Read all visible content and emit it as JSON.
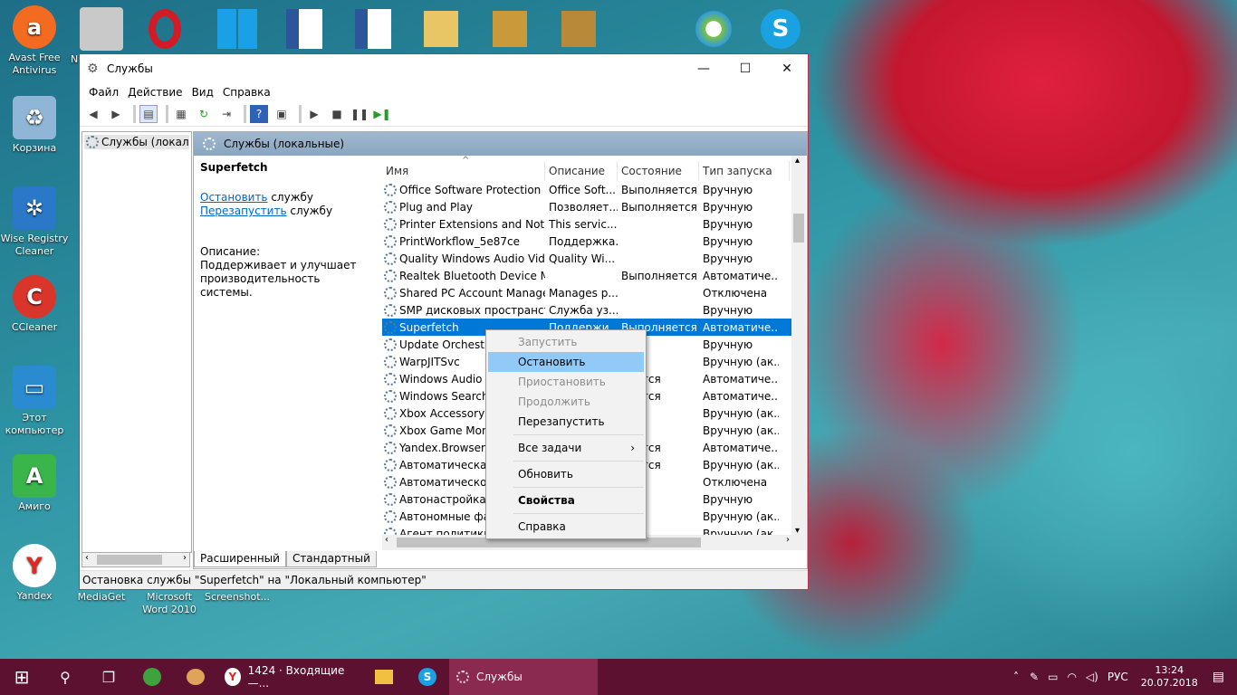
{
  "desktop": {
    "icons": [
      {
        "label": "Avast Free Antivirus",
        "glyph": "a",
        "color": "#f36b21"
      },
      {
        "label": "Корзина",
        "glyph": "♻",
        "color": "#3d7fb5"
      },
      {
        "label": "Wise Registry Cleaner",
        "glyph": "✲",
        "color": "#2a78c7"
      },
      {
        "label": "CCleaner",
        "glyph": "C",
        "color": "#d9352b"
      },
      {
        "label": "Этот компьютер",
        "glyph": "▭",
        "color": "#2a8bd0"
      },
      {
        "label": "Амиго",
        "glyph": "A",
        "color": "#39b54a"
      },
      {
        "label": "Yandex",
        "glyph": "Y",
        "color": "#e52620"
      },
      {
        "label": "MediaGet",
        "glyph": "",
        "color": ""
      },
      {
        "label": "Microsoft Word 2010",
        "glyph": "",
        "color": ""
      },
      {
        "label": "Screenshot...",
        "glyph": "",
        "color": ""
      }
    ],
    "top_row_partial_label": "N"
  },
  "window": {
    "title": "Службы",
    "minimize_glyph": "—",
    "maximize_glyph": "☐",
    "close_glyph": "✕",
    "menu": [
      "Файл",
      "Действие",
      "Вид",
      "Справка"
    ],
    "tree_root": "Службы (локалы",
    "pane_header": "Службы (локальные)",
    "selected_service_title": "Superfetch",
    "stop_link": "Остановить",
    "stop_suffix": " службу",
    "restart_link": "Перезапустить",
    "restart_suffix": " службу",
    "description_label": "Описание:",
    "description_text": "Поддерживает и улучшает производительность системы.",
    "columns": [
      "Имя",
      "Описание",
      "Состояние",
      "Тип запуска"
    ],
    "rows": [
      {
        "name": "Office Software Protection ...",
        "desc": "Office Soft...",
        "state": "Выполняется",
        "start": "Вручную",
        "selected": false
      },
      {
        "name": "Plug and Play",
        "desc": "Позволяет...",
        "state": "Выполняется",
        "start": "Вручную",
        "selected": false
      },
      {
        "name": "Printer Extensions and Notif...",
        "desc": "This servic...",
        "state": "",
        "start": "Вручную",
        "selected": false
      },
      {
        "name": "PrintWorkflow_5e87ce",
        "desc": "Поддержка...",
        "state": "",
        "start": "Вручную",
        "selected": false
      },
      {
        "name": "Quality Windows Audio Vid...",
        "desc": "Quality Wi...",
        "state": "",
        "start": "Вручную",
        "selected": false
      },
      {
        "name": "Realtek Bluetooth Device M...",
        "desc": "",
        "state": "Выполняется",
        "start": "Автоматиче...",
        "selected": false
      },
      {
        "name": "Shared PC Account Manager",
        "desc": "Manages p...",
        "state": "",
        "start": "Отключена",
        "selected": false
      },
      {
        "name": "SMP дисковых пространст...",
        "desc": "Служба уз...",
        "state": "",
        "start": "Вручную",
        "selected": false
      },
      {
        "name": "Superfetch",
        "desc": "Поддержи...",
        "state": "Выполняется",
        "start": "Автоматиче...",
        "selected": true
      },
      {
        "name": "Update Orchestr",
        "desc": "",
        "state": "",
        "start": "Вручную",
        "selected": false
      },
      {
        "name": "WarpJITSvc",
        "desc": "",
        "state": "",
        "start": "Вручную (ак...",
        "selected": false
      },
      {
        "name": "Windows Audio",
        "desc": "",
        "state": "лнется",
        "start": "Автоматиче...",
        "selected": false
      },
      {
        "name": "Windows Search",
        "desc": "",
        "state": "лнется",
        "start": "Автоматиче...",
        "selected": false
      },
      {
        "name": "Xbox Accessory",
        "desc": "",
        "state": "",
        "start": "Вручную (ак...",
        "selected": false
      },
      {
        "name": "Xbox Game Mon",
        "desc": "",
        "state": "",
        "start": "Вручную (ак...",
        "selected": false
      },
      {
        "name": "Yandex.Browser",
        "desc": "",
        "state": "лнется",
        "start": "Автоматиче...",
        "selected": false
      },
      {
        "name": "Автоматическая",
        "desc": "",
        "state": "лнется",
        "start": "Вручную (ак...",
        "selected": false
      },
      {
        "name": "Автоматическо",
        "desc": "",
        "state": "",
        "start": "Отключена",
        "selected": false
      },
      {
        "name": "Автонастройка",
        "desc": "",
        "state": "",
        "start": "Вручную",
        "selected": false
      },
      {
        "name": "Автономные фа",
        "desc": "",
        "state": "",
        "start": "Вручную (ак...",
        "selected": false
      },
      {
        "name": "Агент политики",
        "desc": "",
        "state": "",
        "start": "Вручную (ак...",
        "selected": false
      }
    ],
    "tabs": [
      "Расширенный",
      "Стандартный"
    ],
    "status": "Остановка службы \"Superfetch\" на \"Локальный компьютер\""
  },
  "context_menu": {
    "items": [
      {
        "label": "Запустить",
        "state": "disabled"
      },
      {
        "label": "Остановить",
        "state": "highlighted"
      },
      {
        "label": "Приостановить",
        "state": "disabled"
      },
      {
        "label": "Продолжить",
        "state": "disabled"
      },
      {
        "label": "Перезапустить",
        "state": "normal"
      },
      {
        "sep": true
      },
      {
        "label": "Все задачи",
        "state": "normal",
        "submenu": true
      },
      {
        "sep": true
      },
      {
        "label": "Обновить",
        "state": "normal"
      },
      {
        "sep": true
      },
      {
        "label": "Свойства",
        "state": "bold"
      },
      {
        "sep": true
      },
      {
        "label": "Справка",
        "state": "normal"
      }
    ],
    "submenu_arrow": "›"
  },
  "taskbar": {
    "start_glyph": "⊞",
    "search_glyph": "⚲",
    "taskview_glyph": "❐",
    "yandex_task": "1424 · Входящие —...",
    "services_task": "Службы",
    "lang": "РУС",
    "time": "13:24",
    "date": "20.07.2018",
    "notification_glyph": "▤"
  },
  "colors": {
    "taskbar": "#5d1131",
    "selection": "#0078d7",
    "menu_highlight": "#91c9f7",
    "window_border": "#c23050"
  }
}
